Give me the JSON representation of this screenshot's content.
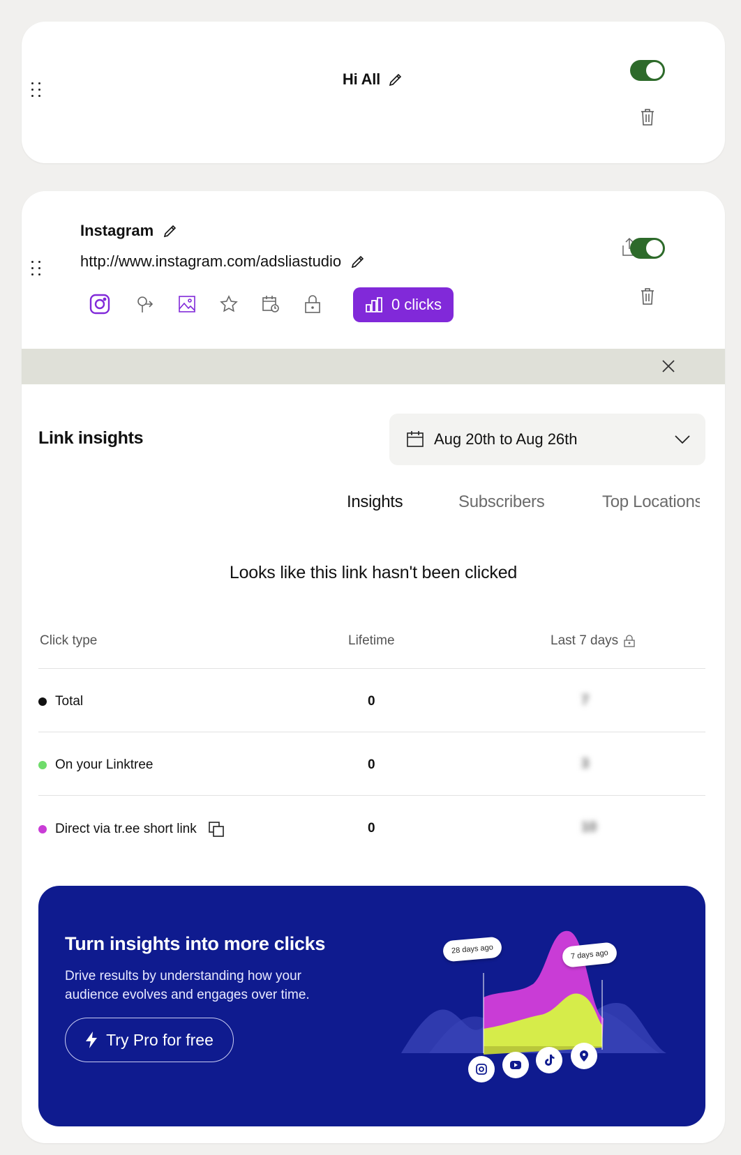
{
  "header_card": {
    "title": "Hi All",
    "toggle_state": "on"
  },
  "link_card": {
    "title": "Instagram",
    "url": "http://www.instagram.com/adsliastudio",
    "toggle_state": "on",
    "clicks_label": "0 clicks",
    "toolbar_icons": [
      "instagram-icon",
      "redirect-icon",
      "image-icon",
      "star-icon",
      "schedule-icon",
      "lock-icon"
    ]
  },
  "insights": {
    "title": "Link insights",
    "date_range": "Aug 20th to Aug 26th",
    "tabs": [
      {
        "label": "Insights",
        "active": true
      },
      {
        "label": "Subscribers",
        "active": false
      },
      {
        "label": "Top Locations",
        "active": false
      }
    ],
    "empty_message": "Looks like this link hasn't been clicked",
    "columns": {
      "click_type": "Click type",
      "lifetime": "Lifetime",
      "last7": "Last 7 days"
    },
    "rows": [
      {
        "label": "Total",
        "dot_color": "#111111",
        "lifetime": "0",
        "last7": "7"
      },
      {
        "label": "On your Linktree",
        "dot_color": "#6fdc6b",
        "lifetime": "0",
        "last7": "3"
      },
      {
        "label": "Direct via tr.ee short link",
        "dot_color": "#c93cd6",
        "lifetime": "0",
        "last7": "10"
      }
    ]
  },
  "promo": {
    "title": "Turn insights into more clicks",
    "body": "Drive results by understanding how your audience evolves and engages over time.",
    "button_label": "Try Pro for free",
    "bubble_left": "28 days ago",
    "bubble_right": "7 days ago",
    "social_icons": [
      "instagram-icon",
      "youtube-icon",
      "tiktok-icon",
      "location-pin-icon"
    ]
  },
  "colors": {
    "background": "#f1f0ee",
    "toggle": "#2d6a2a",
    "accent_purple": "#8129d9",
    "promo_bg": "#0f1b8f",
    "panel_bar": "#dfe0d8"
  }
}
